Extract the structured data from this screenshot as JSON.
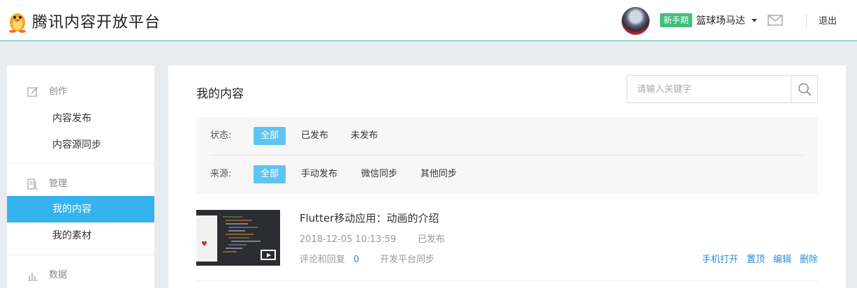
{
  "header": {
    "logo_text": "腾讯内容开放平台",
    "badge": "新手期",
    "username": "篮球场马达",
    "logout": "退出"
  },
  "sidebar": {
    "sections": [
      {
        "label": "创作",
        "icon": "edit-icon"
      },
      {
        "label": "管理",
        "icon": "manage-icon"
      },
      {
        "label": "数据",
        "icon": "chart-icon"
      }
    ],
    "items": [
      {
        "label": "内容发布"
      },
      {
        "label": "内容源同步"
      },
      {
        "label": "我的内容",
        "active": true
      },
      {
        "label": "我的素材"
      }
    ]
  },
  "main": {
    "title": "我的内容",
    "search": {
      "placeholder": "请输入关键字",
      "value": ""
    },
    "filters": {
      "status": {
        "label": "状态:",
        "options": [
          "全部",
          "已发布",
          "未发布"
        ],
        "selected": "全部"
      },
      "source": {
        "label": "来源:",
        "options": [
          "全部",
          "手动发布",
          "微信同步",
          "其他同步"
        ],
        "selected": "全部"
      }
    },
    "items": [
      {
        "title": "Flutter移动应用：动画的介绍",
        "date": "2018-12-05 10:13:59",
        "status": "已发布",
        "comments_label": "评论和回复",
        "comments_count": "0",
        "source": "开发平台同步",
        "actions": [
          "手机打开",
          "置顶",
          "编辑",
          "删除"
        ]
      }
    ]
  },
  "colors": {
    "accent": "#35b3ef",
    "chip_active": "#5ec4f2",
    "link": "#2a8ed8",
    "badge_green": "#3fbf7a",
    "header_line": "#44c1a7"
  }
}
